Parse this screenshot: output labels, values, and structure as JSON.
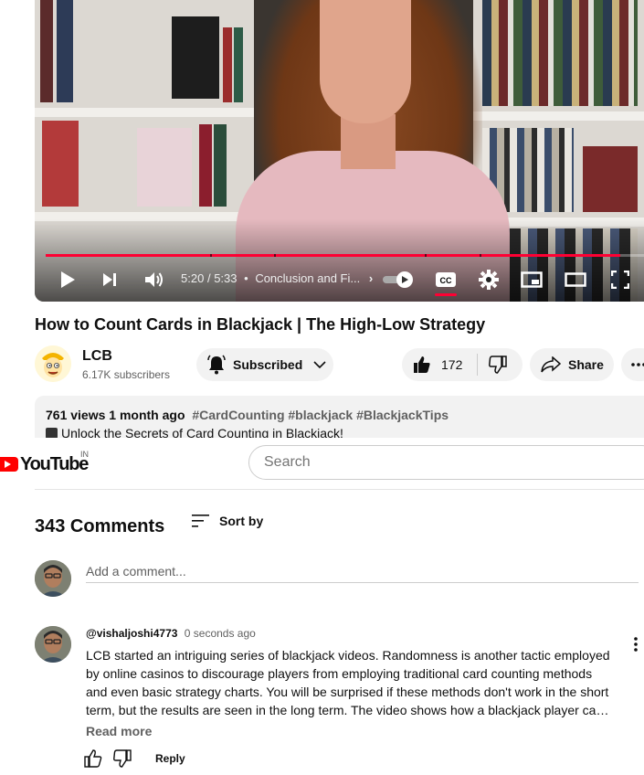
{
  "player": {
    "time_current": "5:20",
    "time_separator": "/",
    "time_total": "5:33",
    "chapter_separator": "•",
    "chapter": "Conclusion and Fi...",
    "progress": 0.96,
    "accent_color": "#ff0033"
  },
  "video": {
    "title": "How to Count Cards in Blackjack | The High-Low Strategy",
    "channel_name": "LCB",
    "subscribers": "6.17K subscribers",
    "subscribe_label": "Subscribed",
    "like_count": "172",
    "share_label": "Share"
  },
  "description": {
    "stats": "761 views  1 month ago",
    "tags": "#CardCounting #blackjack #BlackjackTips",
    "first_line": "Unlock the Secrets of Card Counting in Blackjack!"
  },
  "masthead": {
    "logo_text": "YouTube",
    "country_code": "IN",
    "search_placeholder": "Search"
  },
  "comments": {
    "count_label": "343 Comments",
    "sort_label": "Sort by",
    "add_placeholder": "Add a comment...",
    "items": [
      {
        "author": "@vishaljoshi4773",
        "time": "0 seconds ago",
        "lines": [
          "LCB started an intriguing series of blackjack videos. Randomness is another tactic employed",
          "by online casinos to discourage players from employing traditional card counting methods",
          "and even basic strategy charts. You will be surprised if these methods don't work in the short",
          "term, but the results are seen in the long term. The video shows how a blackjack player can …"
        ],
        "read_more": "Read more",
        "reply_label": "Reply"
      }
    ]
  },
  "icons": {
    "play": "play-icon",
    "next": "next-icon",
    "volume": "volume-icon",
    "autoplay": "autoplay-toggle-icon",
    "cc": "cc-icon",
    "settings": "gear-icon",
    "miniplayer": "miniplayer-icon",
    "theater": "theater-icon",
    "fullscreen": "fullscreen-icon",
    "bell": "bell-icon",
    "like": "thumbs-up-icon",
    "dislike": "thumbs-down-icon",
    "share": "share-icon",
    "sort": "sort-icon"
  }
}
